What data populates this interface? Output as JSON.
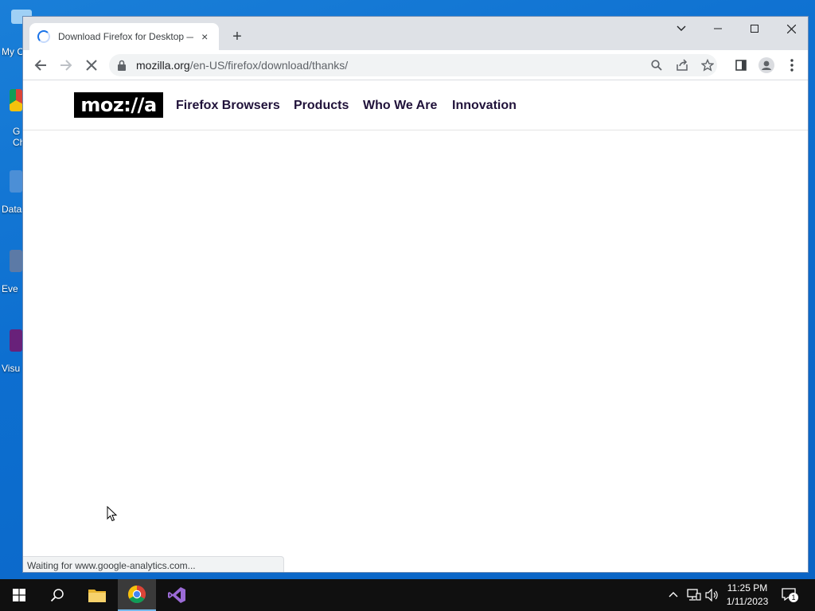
{
  "desktop": {
    "icons": [
      {
        "label": "My C",
        "icon": "computer-icon"
      },
      {
        "label": "G Ch",
        "icon": "chrome-shortcut-icon"
      },
      {
        "label": "Data",
        "icon": "database-shortcut-icon"
      },
      {
        "label": "Eve",
        "icon": "event-viewer-shortcut-icon"
      },
      {
        "label": "Visu",
        "icon": "visual-studio-shortcut-icon"
      }
    ]
  },
  "browser": {
    "tab": {
      "title": "Download Firefox for Desktop —",
      "close": "×"
    },
    "new_tab": "+",
    "address_bar": {
      "domain": "mozilla.org",
      "path": "/en-US/firefox/download/thanks/"
    },
    "status_text": "Waiting for www.google-analytics.com..."
  },
  "page": {
    "logo_text": "moz://a",
    "nav": [
      "Firefox Browsers",
      "Products",
      "Who We Are",
      "Innovation"
    ]
  },
  "taskbar": {
    "time": "11:25 PM",
    "date": "1/11/2023",
    "notification_count": "1"
  },
  "colors": {
    "desktop": "#0d6fd0",
    "accent": "#1a73e8",
    "nav_text": "#20123a"
  }
}
